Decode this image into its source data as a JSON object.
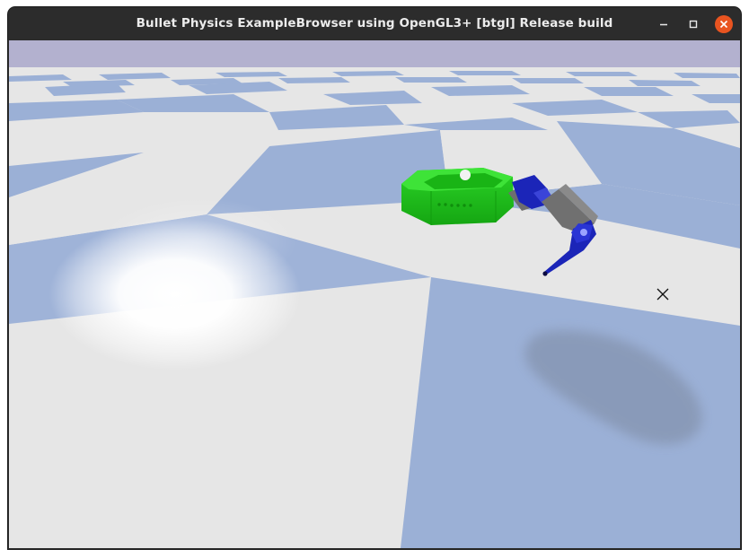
{
  "window": {
    "title": "Bullet Physics ExampleBrowser using OpenGL3+ [btgl] Release build",
    "controls": {
      "minimize": "minimize-icon",
      "maximize": "maximize-icon",
      "close": "close-icon"
    }
  },
  "colors": {
    "titlebar": "#2c2c2c",
    "sky": "#b3b1cf",
    "floor_light": "#e6e6e6",
    "floor_blue": "#9bb0d6",
    "robot_base": "#22c41e",
    "robot_link_gray": "#6e6e6e",
    "robot_link_blue": "#1b25b8",
    "close_button": "#e95420"
  },
  "scene": {
    "objects": [
      "checkerboard-floor",
      "robot-arm-green-base",
      "gray-link",
      "blue-gripper",
      "robot-shadow",
      "light-spot",
      "crosshair-cursor"
    ]
  }
}
